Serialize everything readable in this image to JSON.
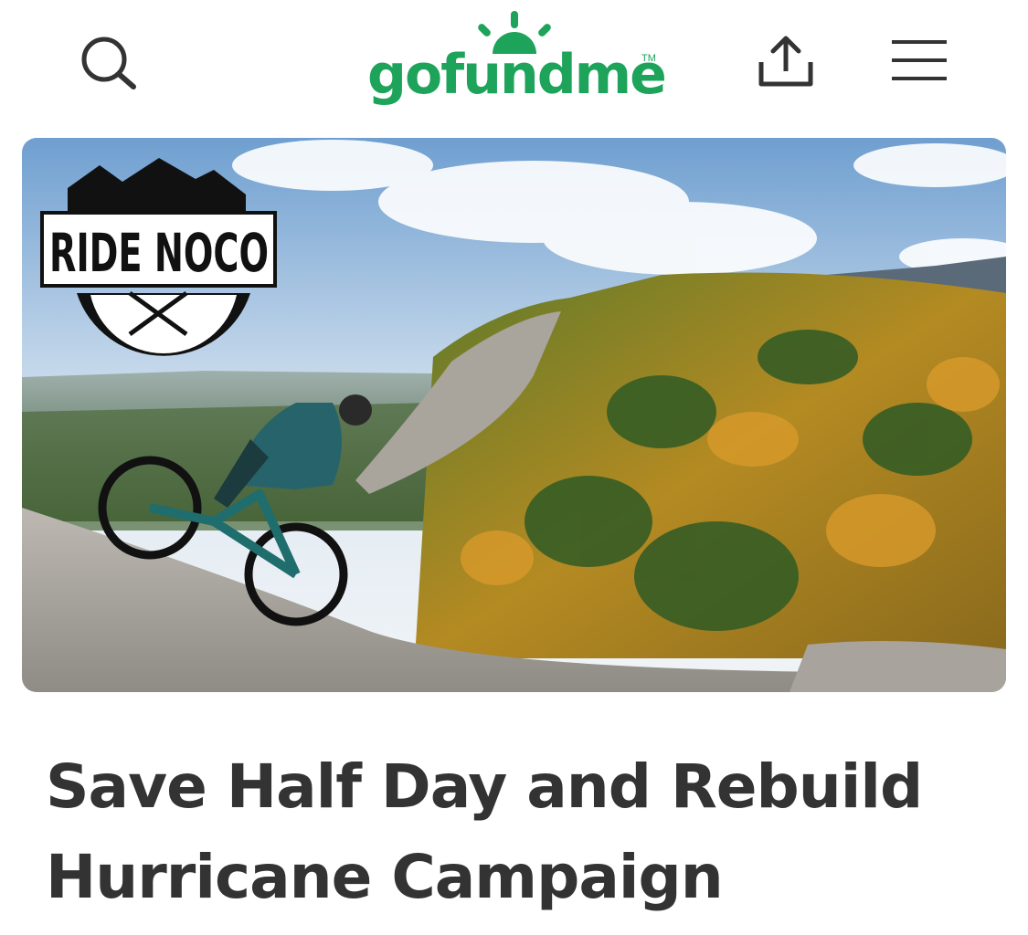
{
  "header": {
    "brand": "gofundme",
    "brand_tm": "TM",
    "icons": {
      "search": "search-icon",
      "share": "share-icon",
      "menu": "hamburger-menu-icon"
    },
    "brand_color": "#1da35a"
  },
  "hero": {
    "logo_text": "RIDE NOCO",
    "scene": "mountain-biker-autumn-forest-image"
  },
  "campaign": {
    "title": "Save Half Day and Rebuild Hurricane Campaign",
    "title_color": "#333333"
  }
}
